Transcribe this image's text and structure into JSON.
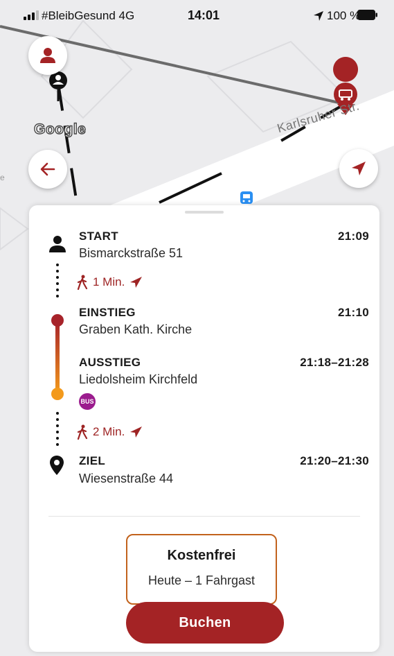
{
  "status_bar": {
    "carrier": "#BleibGesund  4G",
    "time": "14:01",
    "battery": "100 %"
  },
  "map": {
    "attribution": "Google",
    "street_label": "Karlsruher Str.",
    "marker_icon": "car-marker-icon",
    "bus_stop_icon": "bus-stop-icon"
  },
  "buttons": {
    "profile_icon": "person-icon",
    "back_icon": "arrow-left-icon",
    "navigate_icon": "navigation-arrow-icon"
  },
  "itinerary": {
    "start": {
      "title": "START",
      "address": "Bismarckstraße 51",
      "time": "21:09"
    },
    "walk1": {
      "duration": "1 Min."
    },
    "boarding": {
      "title": "EINSTIEG",
      "address": "Graben Kath. Kirche",
      "time": "21:10"
    },
    "alighting": {
      "title": "AUSSTIEG",
      "address": "Liedolsheim Kirchfeld",
      "time": "21:18–21:28"
    },
    "mode_badge": "BUS",
    "walk2": {
      "duration": "2 Min."
    },
    "destination": {
      "title": "ZIEL",
      "address": "Wiesenstraße 44",
      "time": "21:20–21:30"
    }
  },
  "pricing": {
    "title": "Kostenfrei",
    "subtitle": "Heute – 1 Fahrgast"
  },
  "book_button": "Buchen",
  "colors": {
    "brand": "#a42325",
    "line_start": "#a7232a",
    "line_end": "#f39a1c",
    "price_border": "#c2621c",
    "bus_badge": "#9b1c8e"
  }
}
